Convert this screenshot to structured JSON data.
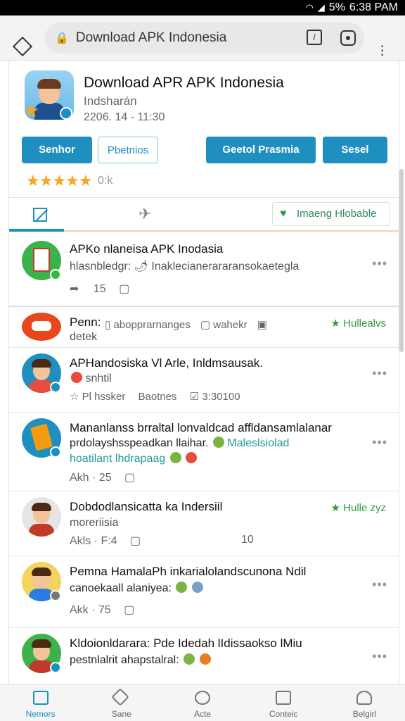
{
  "status": {
    "battery": "5%",
    "time": "6:38 PAM"
  },
  "browser": {
    "url": "Download APK Indonesia"
  },
  "app": {
    "title": "Download APR APK Indonesia",
    "subtitle": "Indsharán",
    "date": "2206. 14 - 11:30",
    "buttons": {
      "b1": "Senhor",
      "b2": "Pbetnios",
      "b3": "Geetol Prasmia",
      "b4": "Sesel"
    },
    "rating_text": "0:k",
    "pill": "Imaeng Hlobable",
    "rating_value": 5
  },
  "feed": [
    {
      "title": "APKo nlaneisa APK Inodasia",
      "line2": "hlasnbledgr: 🌶 Inaklecianerararansokaetegla",
      "meta": "15"
    },
    {
      "title": "Penn:",
      "line2": "detek",
      "tag1": "abopprarnanges",
      "tag2": "wahekr",
      "green": "Hullealvs"
    },
    {
      "title": "APHandosiska Vl Arle, Inldmsausak.",
      "line2": "snhtil",
      "meta1": "Pl hssker",
      "meta2": "Baotnes",
      "meta3": "3:30100"
    },
    {
      "title": "Mananlanss brraltal lonvaldcad affldansamlalanar",
      "line2": "prdolayshsspeadkan llaihar.",
      "line2b": "Maleslsiolad",
      "line3": "hoatilant lhdrapaag",
      "meta": "Akh · 25"
    },
    {
      "title": "Dobdodlansicatta ka Indersiil",
      "line2": "moreriisia",
      "meta": "Akls · F:4",
      "meta_num": "10",
      "green": "Hulle zyz"
    },
    {
      "title": "Pemna HamalaPh inkarialolandscunona Ndil",
      "line2": "canoekaall alaniyea:",
      "meta": "Akk · 75"
    },
    {
      "title": "Kldoionldarara: Pde Idedah lIdissaokso lMiu",
      "line2": "pestnlalrit ahapstalral:"
    }
  ],
  "nav": [
    {
      "label": "Nemors"
    },
    {
      "label": "Sane"
    },
    {
      "label": "Acte"
    },
    {
      "label": "Conteic"
    },
    {
      "label": "Belgirl"
    }
  ],
  "colors": {
    "accent": "#1f8fbf",
    "star": "#f5a623",
    "green": "#2e9b3e"
  }
}
